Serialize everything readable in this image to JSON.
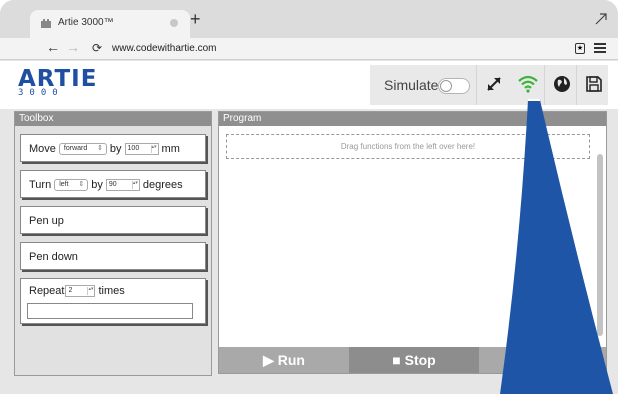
{
  "browser": {
    "tab_title": "Artie 3000™",
    "new_tab": "+",
    "url": "www.codewithartie.com",
    "back": "←",
    "forward": "→",
    "reload": "⟳"
  },
  "app": {
    "logo_main": "ARTIE",
    "logo_sub": "3000",
    "simulate_label": "Simulate",
    "simulate_on": false,
    "toolbar_icons": [
      "fullscreen-icon",
      "wifi-icon",
      "globe-icon",
      "save-icon"
    ],
    "wifi_color": "#3cb43c",
    "accent": "#1f4fa3"
  },
  "toolbox": {
    "title": "Toolbox",
    "move": {
      "label": "Move",
      "direction": "forward",
      "by": "by",
      "amount": "100",
      "unit": "mm"
    },
    "turn": {
      "label": "Turn",
      "direction": "left",
      "by": "by",
      "amount": "90",
      "unit": "degrees"
    },
    "pen_up": "Pen up",
    "pen_down": "Pen down",
    "repeat": {
      "label": "Repeat",
      "count": "2",
      "unit": "times"
    }
  },
  "program": {
    "title": "Program",
    "placeholder": "Drag functions from the left over here!",
    "run_label": "Run",
    "stop_label": "Stop"
  }
}
